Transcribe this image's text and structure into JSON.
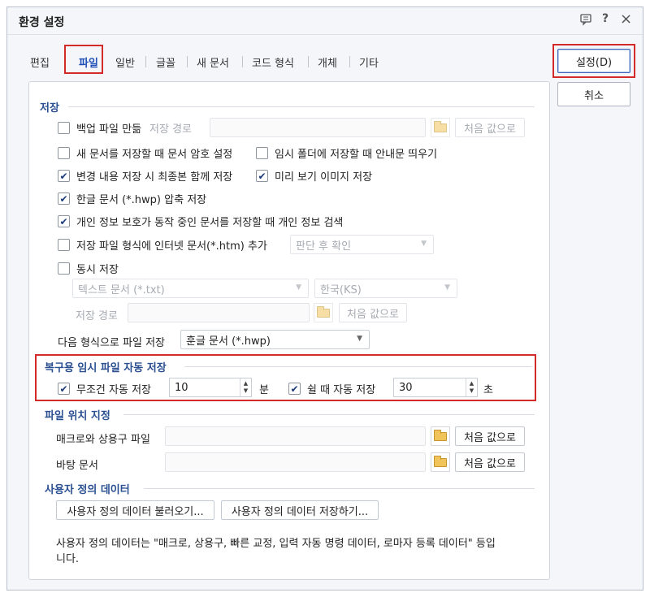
{
  "window": {
    "title": "환경 설정",
    "help_icon": "?",
    "close_icon": "×",
    "comment_icon": "speech-bubble-icon"
  },
  "tabs": [
    {
      "label": "편집"
    },
    {
      "label": "파일",
      "active": true
    },
    {
      "label": "일반"
    },
    {
      "label": "글꼴"
    },
    {
      "label": "새 문서"
    },
    {
      "label": "코드 형식"
    },
    {
      "label": "개체"
    },
    {
      "label": "기타"
    }
  ],
  "buttons": {
    "ok": "설정(D)",
    "cancel": "취소"
  },
  "save_group": {
    "title": "저장",
    "backup": {
      "label": "백업 파일 만듦",
      "checked": false
    },
    "save_path_label": "저장 경로",
    "reset_label": "처음 값으로",
    "password_on_save": {
      "label": "새 문서를 저장할 때 문서 암호 설정",
      "checked": false
    },
    "temp_folder_notice": {
      "label": "임시 폴더에 저장할 때 안내문 띄우기",
      "checked": false
    },
    "save_final_with_changes": {
      "label": "변경 내용 저장 시 최종본 함께 저장",
      "checked": true
    },
    "preview_image": {
      "label": "미리 보기 이미지 저장",
      "checked": true
    },
    "compress_hwp": {
      "label": "한글 문서 (*.hwp) 압축 저장",
      "checked": true
    },
    "privacy_search": {
      "label": "개인 정보 보호가 동작 중인 문서를 저장할 때 개인 정보 검색",
      "checked": true
    },
    "add_htm": {
      "label": "저장 파일 형식에 인터넷 문서(*.htm) 추가",
      "checked": false
    },
    "add_htm_option": "판단 후 확인",
    "simultaneous_save": {
      "label": "동시 저장",
      "checked": false
    },
    "simul_format": "텍스트 문서 (*.txt)",
    "simul_encoding": "한국(KS)",
    "simul_path_label": "저장 경로",
    "simul_reset_label": "처음 값으로",
    "save_as_label": "다음 형식으로 파일 저장",
    "save_as_value": "훈글 문서 (*.hwp)"
  },
  "autosave_group": {
    "title": "복구용 임시 파일 자동 저장",
    "unconditional": {
      "label": "무조건 자동 저장",
      "checked": true,
      "value": "10",
      "unit": "분"
    },
    "idle": {
      "label": "쉴 때 자동 저장",
      "checked": true,
      "value": "30",
      "unit": "초"
    }
  },
  "location_group": {
    "title": "파일 위치 지정",
    "macro_label": "매크로와 상용구 파일",
    "macro_reset": "처음 값으로",
    "desktop_label": "바탕 문서",
    "desktop_reset": "처음 값으로"
  },
  "user_data_group": {
    "title": "사용자 정의 데이터",
    "load_button": "사용자 정의 데이터 불러오기...",
    "save_button": "사용자 정의 데이터 저장하기...",
    "note_line1": "사용자 정의 데이터는 \"매크로, 상용구, 빠른 교정, 입력 자동 명령 데이터, 로마자 등록 데이터\" 등입",
    "note_line2": "니다."
  },
  "colors": {
    "accent": "#2a4f91",
    "highlight": "#d42a2a",
    "check": "#1b3a7a"
  }
}
